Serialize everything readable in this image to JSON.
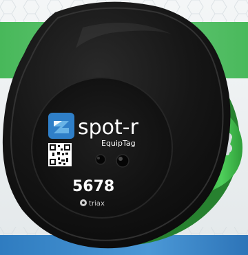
{
  "device": {
    "brand_name": "spot-r",
    "product_name": "EquipTag",
    "tag_number": "5678",
    "manufacturer": "triax"
  },
  "colors": {
    "device_body": "#151515",
    "mount_green": "#3fbf4a",
    "banner_green": "#58c36a",
    "banner_blue": "#3b87c8",
    "logo_blue": "#2f7fc8",
    "logo_light_blue": "#69b3e6"
  },
  "icons": [
    "spot-r-logo-icon",
    "qr-code-icon",
    "triax-logo-icon",
    "led-sensor-icon"
  ]
}
